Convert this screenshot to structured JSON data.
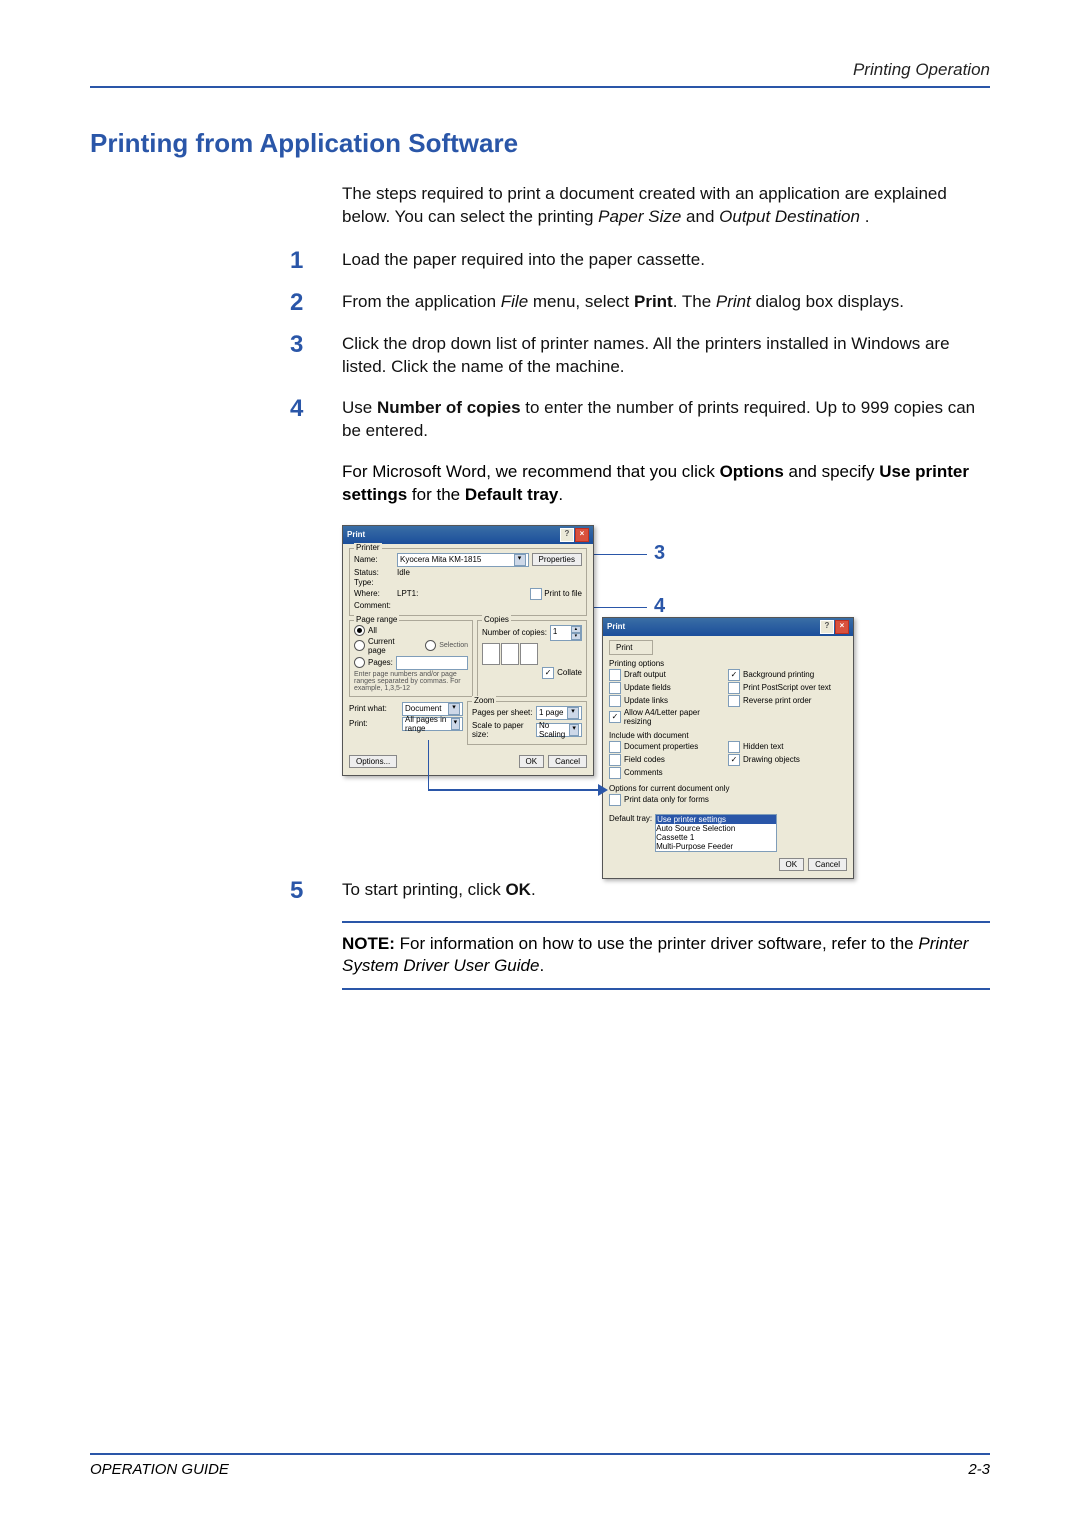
{
  "header": {
    "section_title": "Printing Operation"
  },
  "heading": "Printing from Application Software",
  "intro": {
    "pre": "The steps required to print a document created with an application are explained below. You can select the printing ",
    "i1": "Paper Size",
    "mid": " and ",
    "i2": "Output Destination",
    "post": "."
  },
  "steps": [
    {
      "num": "1",
      "text": "Load the paper required into the paper cassette."
    },
    {
      "num": "2",
      "pre": "From the application ",
      "i1": "File",
      "mid": " menu, select ",
      "b1": "Print",
      "mid2": ". The ",
      "i2": "Print",
      "post": " dialog box displays."
    },
    {
      "num": "3",
      "text": "Click the drop down list of printer names. All the printers installed in Windows are listed. Click the name of the machine."
    },
    {
      "num": "4",
      "pre": "Use ",
      "b1": "Number of copies",
      "post": " to enter the number of prints required. Up to 999 copies can be entered."
    },
    {
      "num": "5",
      "pre": "To start printing, click ",
      "b1": "OK",
      "post": "."
    }
  ],
  "step4_extra": {
    "pre": "For Microsoft Word, we recommend that you click ",
    "b1": "Options",
    "mid": " and specify ",
    "b2": "Use printer settings",
    "mid2": " for the ",
    "b3": "Default tray",
    "post": "."
  },
  "note": {
    "label": "NOTE:",
    "text": " For information on how to use the printer driver software, refer to the ",
    "i1": "Printer System Driver User Guide",
    "post": "."
  },
  "footer": {
    "left": "OPERATION GUIDE",
    "right": "2-3"
  },
  "callouts": {
    "c3": "3",
    "c4": "4"
  },
  "dlg1": {
    "title": "Print",
    "printer_group": "Printer",
    "name_lbl": "Name:",
    "name_val": "Kyocera Mita KM-1815",
    "properties": "Properties",
    "status_lbl": "Status:",
    "status_val": "Idle",
    "type_lbl": "Type:",
    "where_lbl": "Where:",
    "where_val": "LPT1:",
    "comment_lbl": "Comment:",
    "print_to_file": "Print to file",
    "range_group": "Page range",
    "all": "All",
    "current": "Current page",
    "selection": "Selection",
    "pages_lbl": "Pages:",
    "pages_hint": "Enter page numbers and/or page ranges separated by commas. For example, 1,3,5-12",
    "copies_group": "Copies",
    "num_copies_lbl": "Number of copies:",
    "num_copies_val": "1",
    "collate": "Collate",
    "zoom_group": "Zoom",
    "print_what_lbl": "Print what:",
    "print_what_val": "Document",
    "print_lbl": "Print:",
    "print_val": "All pages in range",
    "pages_per_sheet_lbl": "Pages per sheet:",
    "pages_per_sheet_val": "1 page",
    "scale_lbl": "Scale to paper size:",
    "scale_val": "No Scaling",
    "options": "Options...",
    "ok": "OK",
    "cancel": "Cancel"
  },
  "dlg2": {
    "title": "Print",
    "tab": "Print",
    "printing_options": "Printing options",
    "draft": "Draft output",
    "update_fields": "Update fields",
    "update_links": "Update links",
    "allow_a4": "Allow A4/Letter paper resizing",
    "background": "Background printing",
    "ps_over_text": "Print PostScript over text",
    "reverse": "Reverse print order",
    "include": "Include with document",
    "doc_props": "Document properties",
    "field_codes": "Field codes",
    "comments": "Comments",
    "hidden": "Hidden text",
    "drawing": "Drawing objects",
    "opts_current": "Options for current document only",
    "print_data_forms": "Print data only for forms",
    "default_tray_lbl": "Default tray:",
    "tray_highlight": "Use printer settings",
    "tray_items": [
      "Use printer settings",
      "Auto Source Selection",
      "Cassette 1",
      "Multi-Purpose Feeder"
    ],
    "ok": "OK",
    "cancel": "Cancel"
  }
}
